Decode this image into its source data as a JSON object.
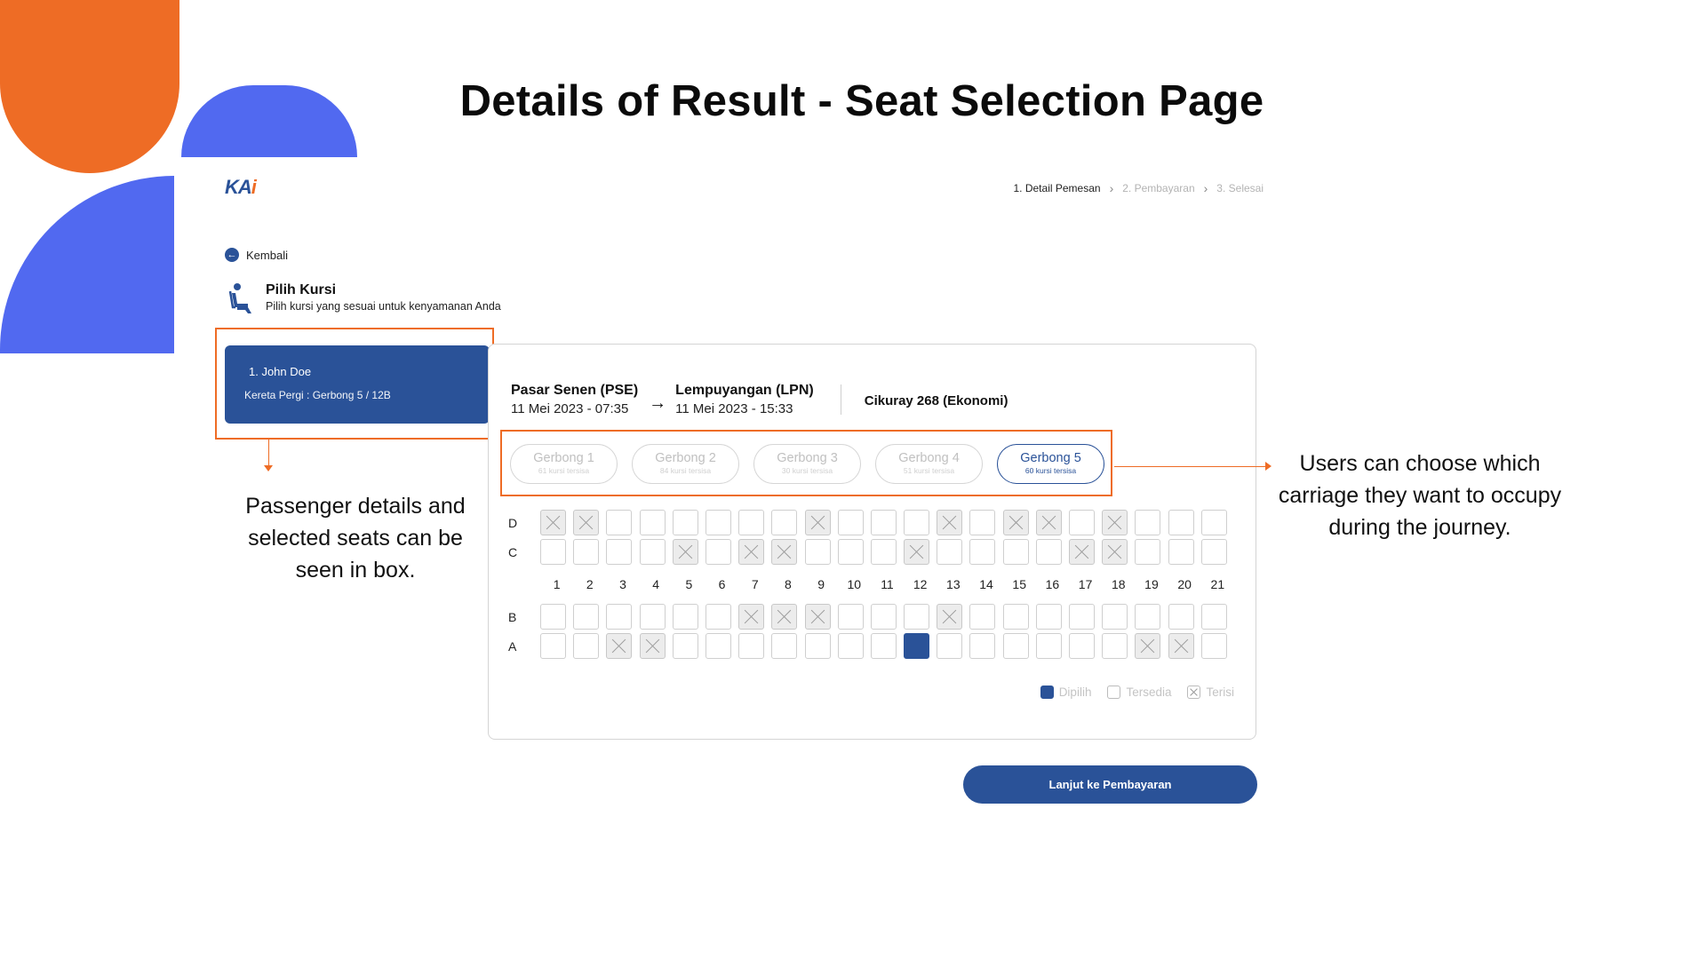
{
  "slide": {
    "title": "Details of Result - Seat Selection Page"
  },
  "header": {
    "logo_main": "KA",
    "logo_accent": "i",
    "steps": [
      {
        "label": "1. Detail Pemesan",
        "active": true
      },
      {
        "label": "2. Pembayaran",
        "active": false
      },
      {
        "label": "3. Selesai",
        "active": false
      }
    ]
  },
  "nav": {
    "back_label": "Kembali"
  },
  "section": {
    "title": "Pilih Kursi",
    "subtitle": "Pilih kursi yang sesuai untuk kenyamanan Anda"
  },
  "passenger": {
    "name": "1. John Doe",
    "seat_info": "Kereta Pergi : Gerbong 5 / 12B"
  },
  "route": {
    "origin": {
      "name": "Pasar Senen (PSE)",
      "time": "11 Mei 2023 - 07:35"
    },
    "destination": {
      "name": "Lempuyangan (LPN)",
      "time": "11 Mei 2023 - 15:33"
    },
    "train": "Cikuray 268 (Ekonomi)"
  },
  "carriages": [
    {
      "name": "Gerbong 1",
      "capacity": "61 kursi tersisa",
      "active": false
    },
    {
      "name": "Gerbong 2",
      "capacity": "84 kursi tersisa",
      "active": false
    },
    {
      "name": "Gerbong 3",
      "capacity": "30 kursi tersisa",
      "active": false
    },
    {
      "name": "Gerbong 4",
      "capacity": "51 kursi tersisa",
      "active": false
    },
    {
      "name": "Gerbong 5",
      "capacity": "60 kursi tersisa",
      "active": true
    }
  ],
  "seat_map": {
    "columns": [
      "1",
      "2",
      "3",
      "4",
      "5",
      "6",
      "7",
      "8",
      "9",
      "10",
      "11",
      "12",
      "13",
      "14",
      "15",
      "16",
      "17",
      "18",
      "19",
      "20",
      "21"
    ],
    "rows_upper": [
      {
        "label": "D",
        "taken": [
          1,
          2,
          9,
          13,
          15,
          16,
          18
        ],
        "selected": []
      },
      {
        "label": "C",
        "taken": [
          5,
          7,
          8,
          12,
          17,
          18
        ],
        "selected": []
      }
    ],
    "rows_lower": [
      {
        "label": "B",
        "taken": [
          7,
          8,
          9,
          13
        ],
        "selected": []
      },
      {
        "label": "A",
        "taken": [
          3,
          4,
          19,
          20
        ],
        "selected": [
          12
        ]
      }
    ]
  },
  "legend": {
    "selected": "Dipilih",
    "available": "Tersedia",
    "taken": "Terisi"
  },
  "cta_label": "Lanjut ke Pembayaran",
  "annotations": {
    "left": "Passenger details and selected seats can be seen in box.",
    "right": "Users can choose which carriage they want to occupy during the journey."
  },
  "colors": {
    "primary": "#2a5298",
    "accent": "#EE6C25",
    "decor_blue": "#5169F0"
  }
}
